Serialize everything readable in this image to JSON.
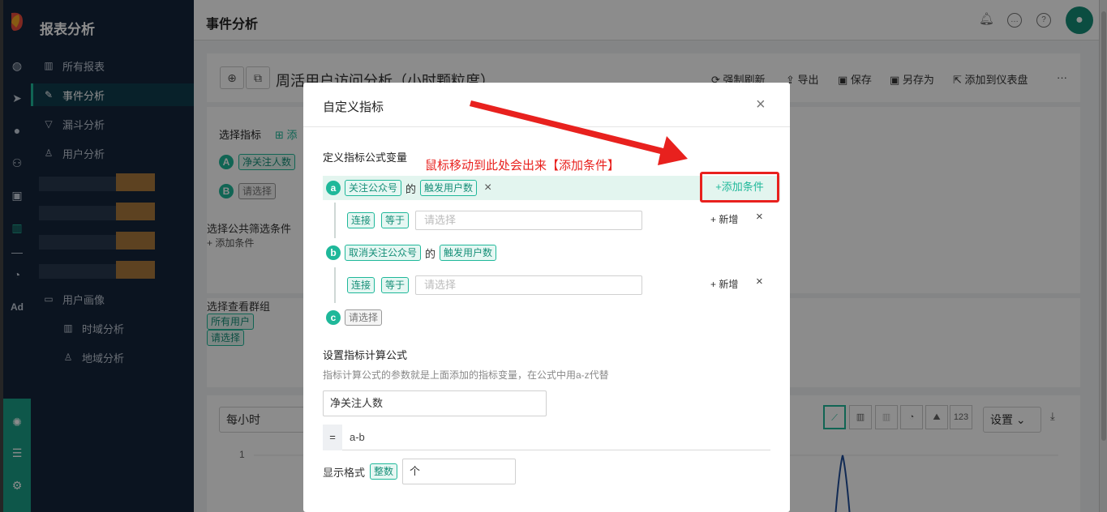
{
  "app": {
    "menu_title": "报表分析",
    "page_title": "事件分析"
  },
  "rail_icons": [
    "globe-icon",
    "send-icon",
    "user-icon",
    "users-icon",
    "bookmark-icon",
    "bar-chart-icon",
    "minus-icon",
    "wechat-icon",
    "ad-icon"
  ],
  "rail_ad_label": "Ad",
  "menu": {
    "items": [
      {
        "label": "所有报表",
        "icon": "bar-chart-icon"
      },
      {
        "label": "事件分析",
        "icon": "edit-icon",
        "active": true
      },
      {
        "label": "漏斗分析",
        "icon": "funnel-icon"
      },
      {
        "label": "用户分析",
        "icon": "user-icon"
      },
      {
        "label": "用户画像",
        "icon": "folder-icon"
      },
      {
        "label": "时域分析",
        "icon": "bar-chart-icon"
      },
      {
        "label": "地域分析",
        "icon": "user-icon"
      }
    ]
  },
  "report": {
    "name": "周活用户访问分析（小时颗粒度）",
    "actions": [
      "强制刷新",
      "导出",
      "保存",
      "另存为",
      "添加到仪表盘"
    ],
    "more": "···",
    "select_metric_label": "选择指标",
    "select_metric_add": "添",
    "metric_a_letter": "A",
    "metric_a_tag": "净关注人数",
    "metric_b_letter": "B",
    "metric_b_tag": "请选择",
    "filter_label": "选择公共筛选条件",
    "filter_add": "+ 添加条件",
    "group_label": "选择查看群组",
    "group_all": "所有用户",
    "group_select": "请选择",
    "granularity": "每小时",
    "y_tick": "1",
    "chart_types": [
      "line-chart-icon",
      "bar-chart-icon",
      "stacked-bar-icon",
      "pie-chart-icon",
      "area-chart-icon",
      "123"
    ],
    "settings": "设置",
    "download_icon": "download-icon"
  },
  "modal": {
    "title": "自定义指标",
    "close": "×",
    "vars_label": "定义指标公式变量",
    "annotation": "鼠标移动到此处会出来【添加条件】",
    "add_condition": "+添加条件",
    "var_a": {
      "letter": "a",
      "event": "关注公众号",
      "of": "的",
      "measure": "触发用户数",
      "remove": "×"
    },
    "cond_a": {
      "connector": "连接",
      "operator": "等于",
      "placeholder": "请选择",
      "new": "+ 新增",
      "remove": "×"
    },
    "var_b": {
      "letter": "b",
      "event": "取消关注公众号",
      "of": "的",
      "measure": "触发用户数"
    },
    "cond_b": {
      "connector": "连接",
      "operator": "等于",
      "placeholder": "请选择",
      "new": "+ 新增",
      "remove": "×"
    },
    "var_c": {
      "letter": "c",
      "placeholder": "请选择"
    },
    "formula_label": "设置指标计算公式",
    "formula_hint": "指标计算公式的参数就是上面添加的指标变量，在公式中用a-z代替",
    "metric_name": "净关注人数",
    "eq": "=",
    "expression": "a-b",
    "format_label": "显示格式",
    "format_type": "整数",
    "unit": "个"
  },
  "colors": {
    "accent": "#1fb89a",
    "sidebar": "#15253b",
    "annotation": "#e8211e"
  }
}
